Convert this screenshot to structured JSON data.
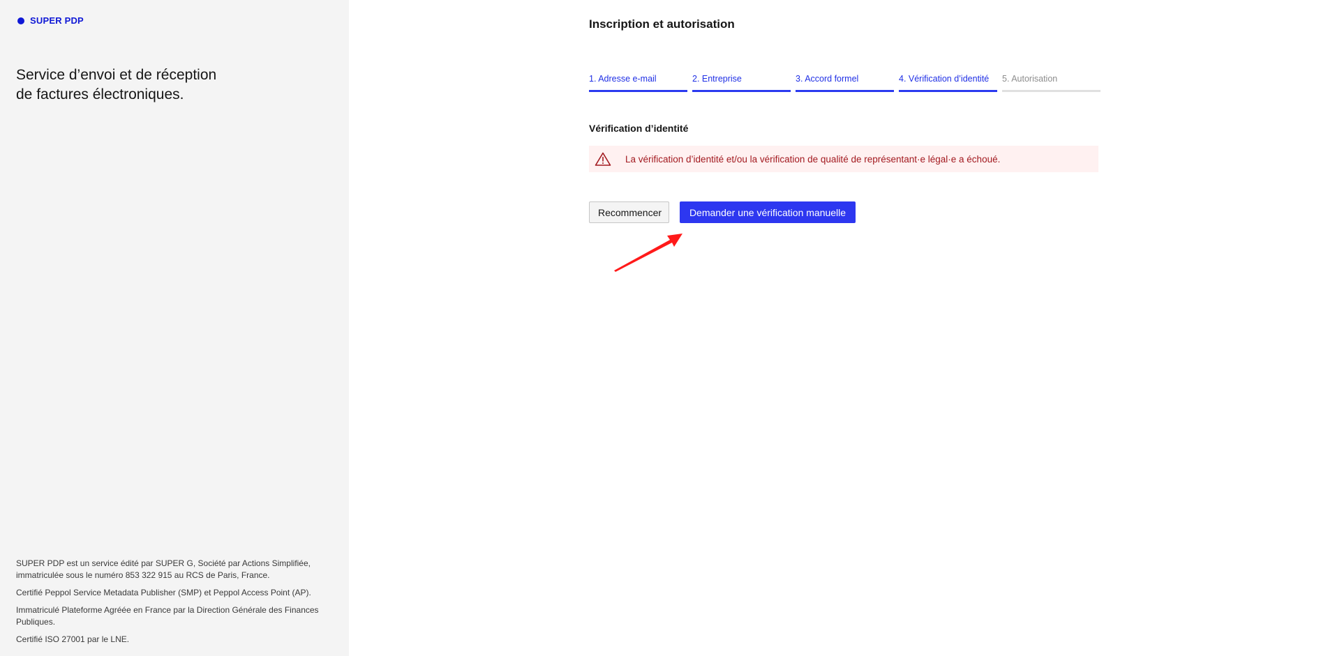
{
  "sidebar": {
    "brand": "SUPER PDP",
    "tagline_line1": "Service d’envoi et de réception",
    "tagline_line2": "de factures électroniques.",
    "footer": {
      "line1": "SUPER PDP est un service édité par SUPER G, Société par Actions Simplifiée, immatriculée sous le numéro 853 322 915 au RCS de Paris, France.",
      "line2": "Certifié Peppol Service Metadata Publisher (SMP) et Peppol Access Point (AP).",
      "line3": "Immatriculé Plateforme Agréée en France par la Direction Générale des Finances Publiques.",
      "line4": "Certifié ISO 27001 par le LNE."
    }
  },
  "main": {
    "title": "Inscription et autorisation",
    "steps": [
      {
        "label": "1. Adresse e-mail",
        "state": "done"
      },
      {
        "label": "2. Entreprise",
        "state": "done"
      },
      {
        "label": "3. Accord formel",
        "state": "done"
      },
      {
        "label": "4. Vérification d’identité",
        "state": "current"
      },
      {
        "label": "5. Autorisation",
        "state": "pending"
      }
    ],
    "section_title": "Vérification d’identité",
    "alert": {
      "icon": "warning-triangle-icon",
      "text": "La vérification d’identité et/ou la vérification de qualité de représentant·e légal·e a échoué."
    },
    "buttons": {
      "restart": "Recommencer",
      "manual_verification": "Demander une vérification manuelle"
    }
  },
  "colors": {
    "accent": "#2d37f0",
    "brand": "#0f18d6",
    "alert_bg": "#fff1f1",
    "alert_text": "#a2191f",
    "annotation_arrow": "#ff1a1a"
  }
}
